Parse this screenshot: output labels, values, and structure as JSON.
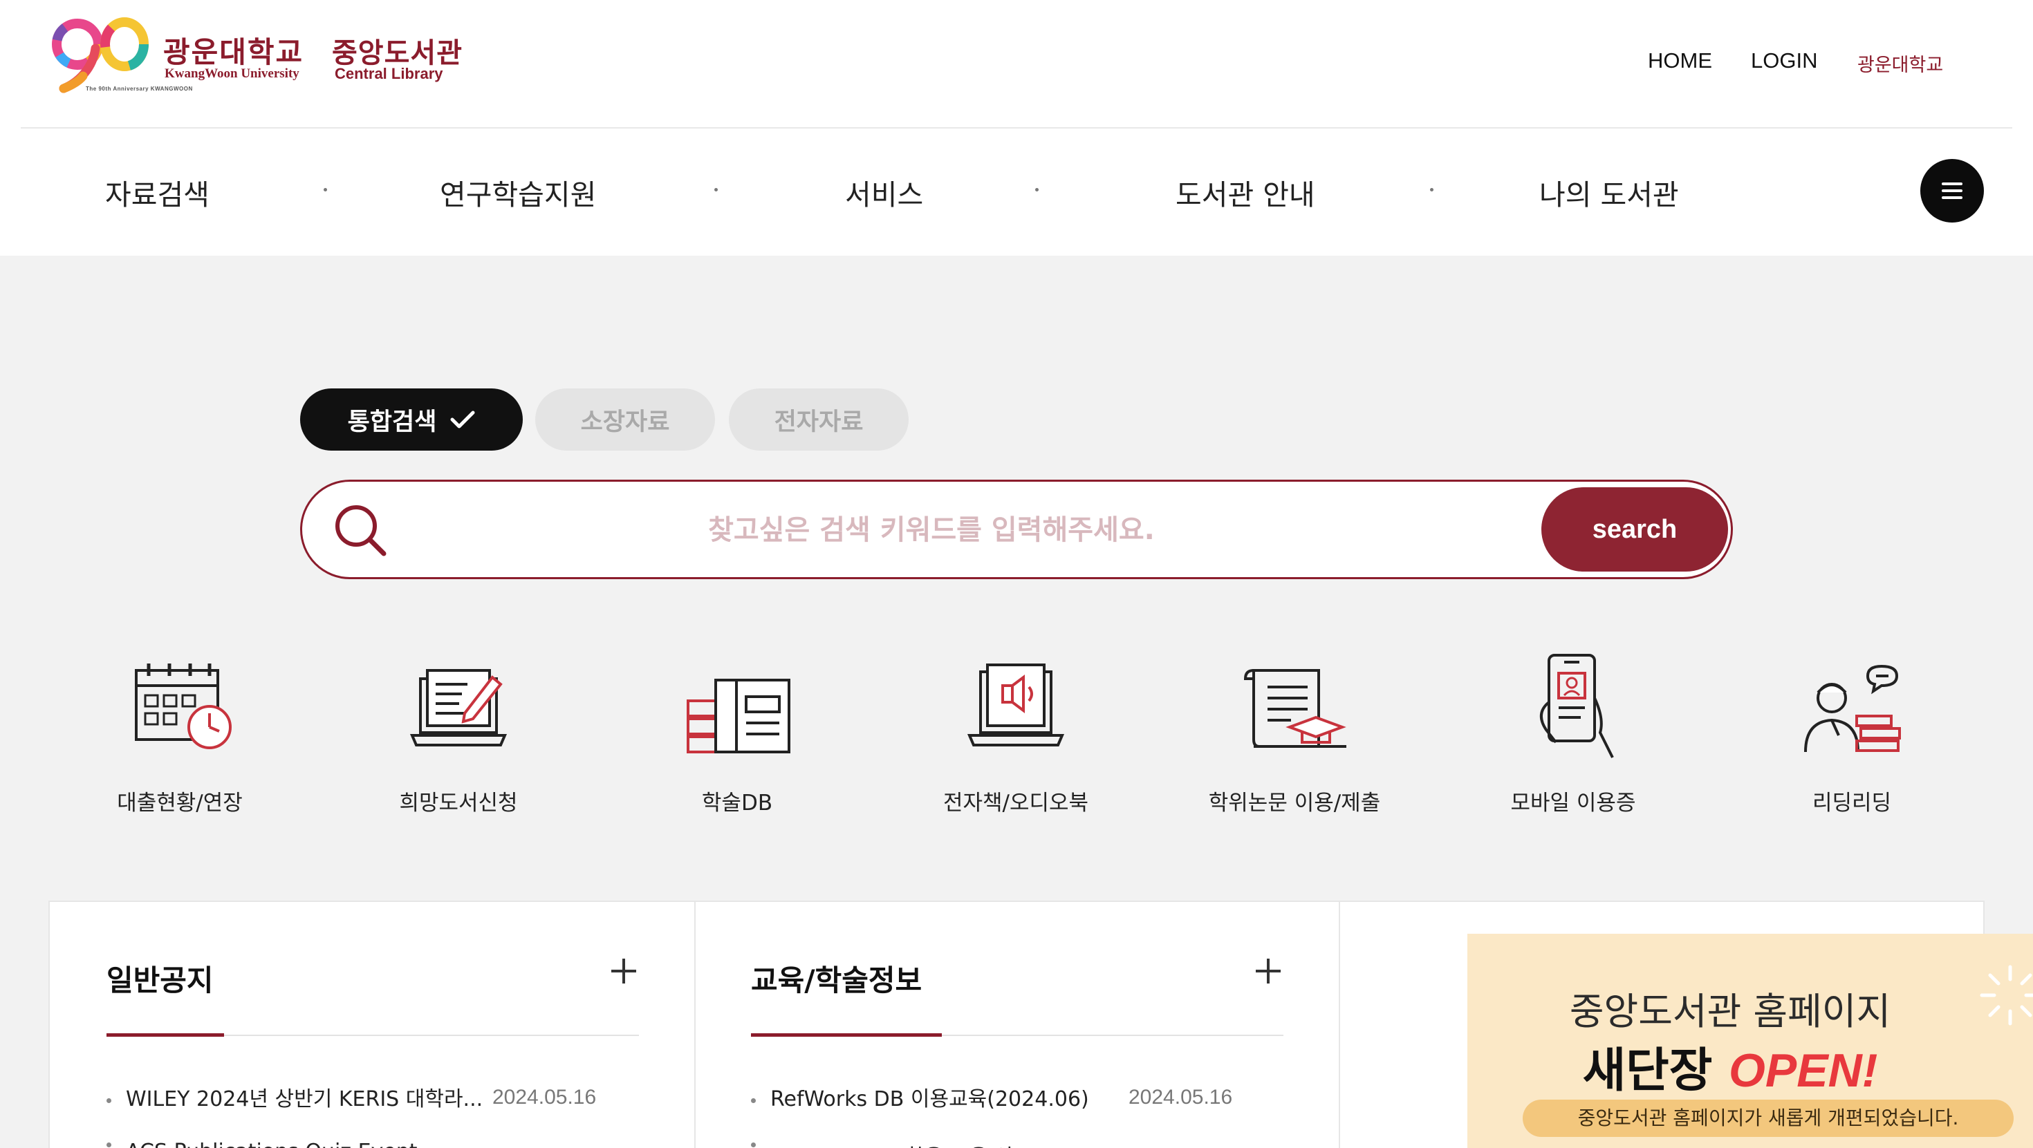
{
  "header": {
    "logo": {
      "anniversary_badge": "The 90th Anniversary KWANGWOON",
      "univ_ko": "광운대학교",
      "lib_ko": "중앙도서관",
      "univ_en": "KwangWoon University",
      "lib_en": "Central Library"
    },
    "util_links": {
      "home": "HOME",
      "login": "LOGIN",
      "univ": "광운대학교"
    },
    "gnb": [
      "자료검색",
      "연구학습지원",
      "서비스",
      "도서관 안내",
      "나의 도서관"
    ],
    "menu_icon": "hamburger-icon"
  },
  "search": {
    "tabs": [
      {
        "label": "통합검색",
        "active": true
      },
      {
        "label": "소장자료",
        "active": false
      },
      {
        "label": "전자자료",
        "active": false
      }
    ],
    "placeholder": "찾고싶은 검색 키워드를 입력해주세요.",
    "value": "",
    "button": "search",
    "accent_color": "#8e2432"
  },
  "quick_menu": [
    {
      "label": "대출현황/연장",
      "icon": "calendar-clock-icon"
    },
    {
      "label": "희망도서신청",
      "icon": "laptop-pencil-icon"
    },
    {
      "label": "학술DB",
      "icon": "books-database-icon"
    },
    {
      "label": "전자책/오디오북",
      "icon": "ebook-audio-icon"
    },
    {
      "label": "학위논문 이용/제출",
      "icon": "thesis-graduation-icon"
    },
    {
      "label": "모바일 이용증",
      "icon": "mobile-id-icon"
    },
    {
      "label": "리딩리딩",
      "icon": "reading-talk-icon"
    }
  ],
  "boards": [
    {
      "title": "일반공지",
      "posts": [
        {
          "title": "WILEY 2024년 상반기 KERIS 대학라...",
          "date": "2024.05.16"
        },
        {
          "title": "ACS Publications Quiz Event",
          "date": ""
        }
      ]
    },
    {
      "title": "교육/학술정보",
      "posts": [
        {
          "title": "RefWorks DB 이용교육(2024.06)",
          "date": "2024.05.16"
        },
        {
          "title": "ValueSearch 활용 교육 안",
          "date": ""
        }
      ]
    }
  ],
  "banner": {
    "line1": "중앙도서관 홈페이지",
    "line2_main": "새단장",
    "line2_accent": "OPEN!",
    "line3": "중앙도서관 홈페이지가 새롭게 개편되었습니다."
  }
}
